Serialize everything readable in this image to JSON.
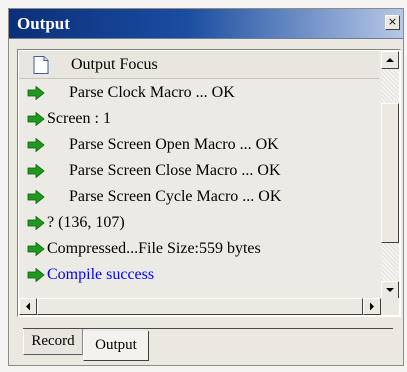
{
  "window": {
    "title": "Output",
    "close_label": "×"
  },
  "header": {
    "label": "Output Focus",
    "icon": "document-icon"
  },
  "rows": [
    {
      "text": "Parse Clock Macro ... OK",
      "icon": "green-arrow-icon",
      "color": "#000000",
      "indent": true
    },
    {
      "text": "Screen : 1",
      "icon": "green-arrow-icon",
      "color": "#000000",
      "indent": false
    },
    {
      "text": "Parse Screen Open Macro ... OK",
      "icon": "green-arrow-icon",
      "color": "#000000",
      "indent": true
    },
    {
      "text": "Parse Screen Close Macro ... OK",
      "icon": "green-arrow-icon",
      "color": "#000000",
      "indent": true
    },
    {
      "text": "Parse Screen Cycle Macro ... OK",
      "icon": "green-arrow-icon",
      "color": "#000000",
      "indent": true
    },
    {
      "text": "? (136, 107)",
      "icon": "green-arrow-icon",
      "color": "#000000",
      "indent": false
    },
    {
      "text": "Compressed...File Size:559 bytes",
      "icon": "green-arrow-icon",
      "color": "#000000",
      "indent": false
    },
    {
      "text": "Compile success",
      "icon": "green-arrow-icon",
      "color": "#0000ff",
      "indent": false
    }
  ],
  "tabs": [
    {
      "label": "Record",
      "active": false
    },
    {
      "label": "Output",
      "active": true
    }
  ],
  "colors": {
    "arrow": "#1f9a1f",
    "success_text": "#0000ff",
    "title_bar": "#0b2f7a"
  }
}
